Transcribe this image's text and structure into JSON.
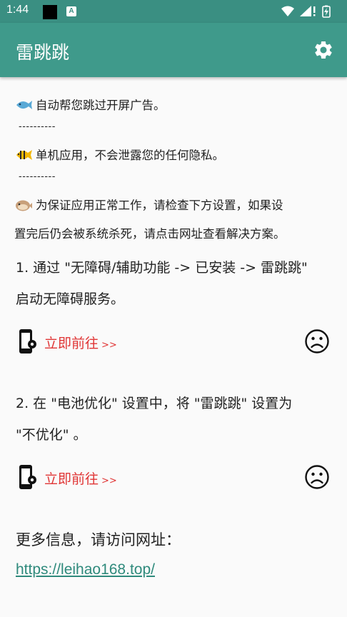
{
  "status_bar": {
    "time": "1:44",
    "notification_letter": "A"
  },
  "app_bar": {
    "title": "雷跳跳",
    "settings_icon": "gear-icon"
  },
  "intro": {
    "line1": "自动帮您跳过开屏广告。",
    "divider1": "----------",
    "line2": "单机应用，不会泄露您的任何隐私。",
    "divider2": "----------",
    "line3a": "为保证应用正常工作，请检查下方设置，如果设",
    "line3b": "置完后仍会被系统杀死，请点击网址查看解决方案。"
  },
  "steps": [
    {
      "text_a": "1. 通过 \"无障碍/辅助功能 -> 已安装 -> 雷跳跳\"",
      "text_b": "启动无障碍服务。",
      "action_label": "立即前往",
      "action_arrows": ">>",
      "status_icon": "sad-face-icon"
    },
    {
      "text_a": "2. 在 \"电池优化\" 设置中，将 \"雷跳跳\" 设置为",
      "text_b": "\"不优化\" 。",
      "action_label": "立即前往",
      "action_arrows": ">>",
      "status_icon": "sad-face-icon"
    }
  ],
  "footer": {
    "more_info": "更多信息，请访问网址：",
    "link": "https://leihao168.top/"
  },
  "colors": {
    "appbar": "#3f9a8b",
    "statusbar": "#3a8f82",
    "action_red": "#e03535",
    "link": "#2f8a7c"
  }
}
